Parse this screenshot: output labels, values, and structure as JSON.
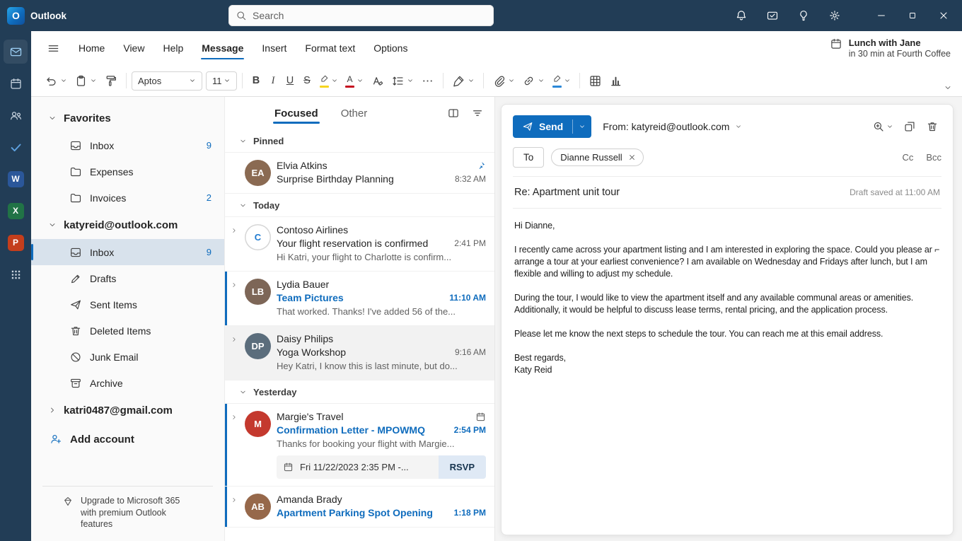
{
  "titlebar": {
    "app_name": "Outlook",
    "search_placeholder": "Search"
  },
  "rail": {
    "items": [
      {
        "name": "mail",
        "icon": "mail",
        "active": true
      },
      {
        "name": "calendar",
        "icon": "calendar"
      },
      {
        "name": "people",
        "icon": "people"
      },
      {
        "name": "to-do",
        "icon": "check",
        "color": "#5ea2e0"
      },
      {
        "name": "word",
        "letter": "W",
        "color": "#2b579a"
      },
      {
        "name": "excel",
        "letter": "X",
        "color": "#217346"
      },
      {
        "name": "powerpoint",
        "letter": "P",
        "color": "#c43e1c"
      },
      {
        "name": "apps",
        "icon": "grid"
      }
    ]
  },
  "ribbon": {
    "tabs": [
      {
        "label": "Home"
      },
      {
        "label": "View"
      },
      {
        "label": "Help"
      },
      {
        "label": "Message",
        "active": true
      },
      {
        "label": "Insert"
      },
      {
        "label": "Format text"
      },
      {
        "label": "Options"
      }
    ],
    "reminder_title": "Lunch with Jane",
    "reminder_subtitle": "in 30 min at Fourth Coffee",
    "font_name": "Aptos",
    "font_size": "11",
    "bold_glyph": "B",
    "italic_glyph": "I",
    "underline_glyph": "U",
    "strike_glyph": "S",
    "fontcolor_glyph": "A",
    "highlight_color": "#f6d51f",
    "font_color": "#c50f1f",
    "ink_color": "#2b88d8"
  },
  "sidebar": {
    "sections": [
      {
        "label": "Favorites",
        "expanded": true,
        "items": [
          {
            "label": "Inbox",
            "icon": "inbox",
            "count": "9"
          },
          {
            "label": "Expenses",
            "icon": "folder",
            "count": ""
          },
          {
            "label": "Invoices",
            "icon": "folder",
            "count": "2"
          }
        ]
      },
      {
        "label": "katyreid@outlook.com",
        "expanded": true,
        "items": [
          {
            "label": "Inbox",
            "icon": "inbox",
            "count": "9",
            "selected": true
          },
          {
            "label": "Drafts",
            "icon": "drafts",
            "count": ""
          },
          {
            "label": "Sent Items",
            "icon": "sent",
            "count": ""
          },
          {
            "label": "Deleted Items",
            "icon": "trash",
            "count": ""
          },
          {
            "label": "Junk Email",
            "icon": "junk",
            "count": ""
          },
          {
            "label": "Archive",
            "icon": "archive",
            "count": ""
          }
        ]
      },
      {
        "label": "katri0487@gmail.com",
        "expanded": false,
        "items": []
      }
    ],
    "add_account_label": "Add account",
    "upgrade_text": "Upgrade to Microsoft 365 with premium Outlook features"
  },
  "message_list": {
    "tab_focused": "Focused",
    "tab_other": "Other",
    "groups": [
      {
        "header": "Pinned",
        "items": [
          {
            "sender": "Elvia Atkins",
            "subject": "Surprise Birthday Planning",
            "preview": "",
            "time": "8:32 AM",
            "pinned": true,
            "avatar_text": "EA",
            "avatar_bg": "#8a6a52"
          }
        ]
      },
      {
        "header": "Today",
        "items": [
          {
            "sender": "Contoso Airlines",
            "subject": "Your flight reservation is confirmed",
            "preview": "Hi Katri, your flight to Charlotte is confirm...",
            "time": "2:41 PM",
            "expander": true,
            "avatar_text": "C",
            "avatar_bg": "#ffffff",
            "avatar_fg": "#1e7ad0",
            "avatar_border": true
          },
          {
            "sender": "Lydia Bauer",
            "subject": "Team Pictures",
            "preview": "That worked. Thanks! I've added 56 of the...",
            "time": "11:10 AM",
            "unread": true,
            "expander": true,
            "avatar_text": "LB",
            "avatar_bg": "#7d6657"
          },
          {
            "sender": "Daisy Philips",
            "subject": "Yoga Workshop",
            "preview": "Hey Katri, I know this is last minute, but do...",
            "time": "9:16 AM",
            "selected": true,
            "expander": true,
            "avatar_text": "DP",
            "avatar_bg": "#5b6d7c"
          }
        ]
      },
      {
        "header": "Yesterday",
        "items": [
          {
            "sender": "Margie's Travel",
            "subject": "Confirmation Letter - MPOWMQ",
            "preview": "Thanks for booking your flight with Margie...",
            "time": "2:54 PM",
            "unread": true,
            "expander": true,
            "calendar_icon": true,
            "avatar_text": "M",
            "avatar_bg": "#c4392e",
            "rsvp": {
              "date": "Fri 11/22/2023 2:35 PM -...",
              "button": "RSVP"
            }
          },
          {
            "sender": "Amanda Brady",
            "subject": "Apartment Parking Spot Opening",
            "preview": "",
            "time": "1:18 PM",
            "unread": true,
            "expander": true,
            "avatar_text": "AB",
            "avatar_bg": "#96684a"
          }
        ]
      }
    ]
  },
  "compose": {
    "send_label": "Send",
    "from_label": "From: katyreid@outlook.com",
    "to_label": "To",
    "recipient": "Dianne Russell",
    "cc_label": "Cc",
    "bcc_label": "Bcc",
    "subject": "Re: Apartment unit tour",
    "draft_status": "Draft saved at 11:00 AM",
    "body_paragraphs": [
      [
        "Hi Dianne,"
      ],
      [
        "I recently came across your apartment listing and I am interested in exploring the space. Could you please ar ⌐",
        "arrange a tour at your earliest convenience? I am available on Wednesday and Fridays after lunch, but I am",
        "flexible and willing to adjust my schedule."
      ],
      [
        "During the tour, I would like to view the apartment itself and any available communal areas or amenities.",
        "Additionally, it would be helpful to discuss lease terms, rental pricing, and the application process."
      ],
      [
        "Please let me know the next steps to schedule the tour. You can reach me at this email address."
      ],
      [
        "Best regards,",
        "Katy Reid"
      ]
    ]
  }
}
